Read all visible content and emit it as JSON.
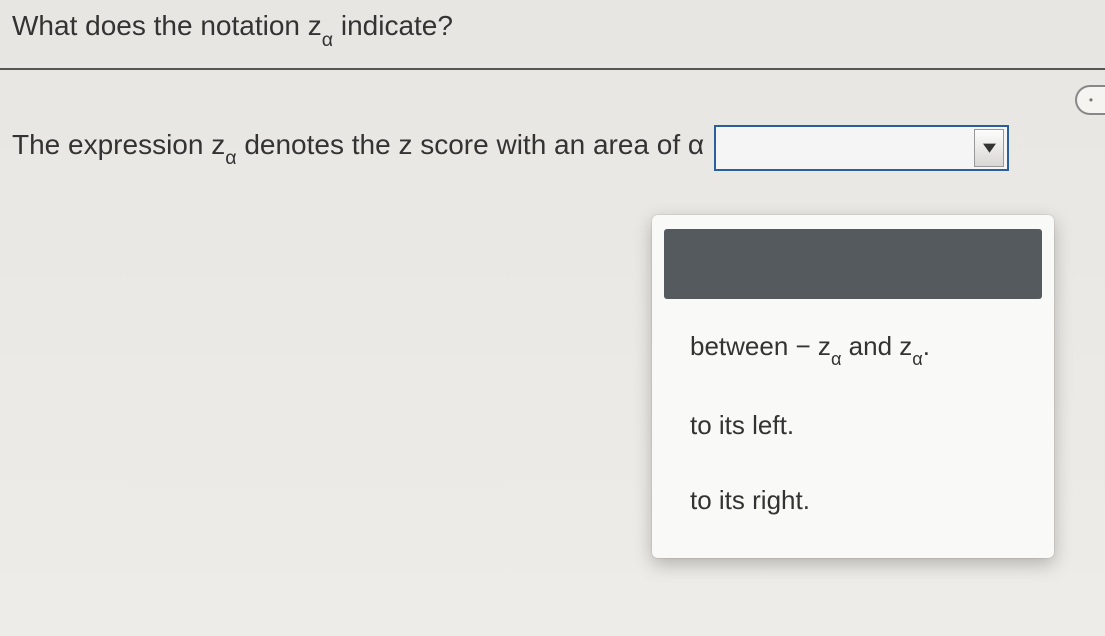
{
  "question": {
    "prefix": "What does the notation z",
    "subscript": "α",
    "suffix": " indicate?"
  },
  "prompt": {
    "prefix": "The expression z",
    "subscript1": "α",
    "mid": " denotes the z score with an area of α"
  },
  "dropdown": {
    "selected": "",
    "options": {
      "opt1_prefix": "between  − z",
      "opt1_sub1": "α",
      "opt1_mid": " and z",
      "opt1_sub2": "α",
      "opt1_suffix": ".",
      "opt2": "to its left.",
      "opt3": "to its right."
    }
  }
}
